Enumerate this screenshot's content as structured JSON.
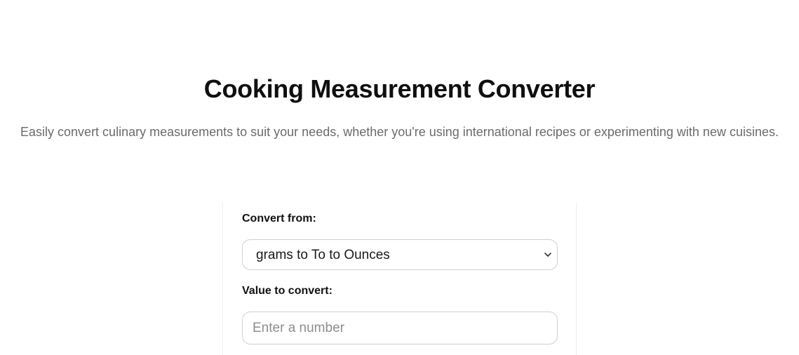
{
  "header": {
    "title": "Cooking Measurement Converter",
    "subtitle": "Easily convert culinary measurements to suit your needs, whether you're using international recipes or experimenting with new cuisines."
  },
  "form": {
    "convert_from_label": "Convert from:",
    "convert_from_selected": "grams to To to Ounces",
    "value_label": "Value to convert:",
    "value_placeholder": "Enter a number",
    "value_current": ""
  },
  "icons": {
    "select_chevron": "chevron-down-icon"
  }
}
